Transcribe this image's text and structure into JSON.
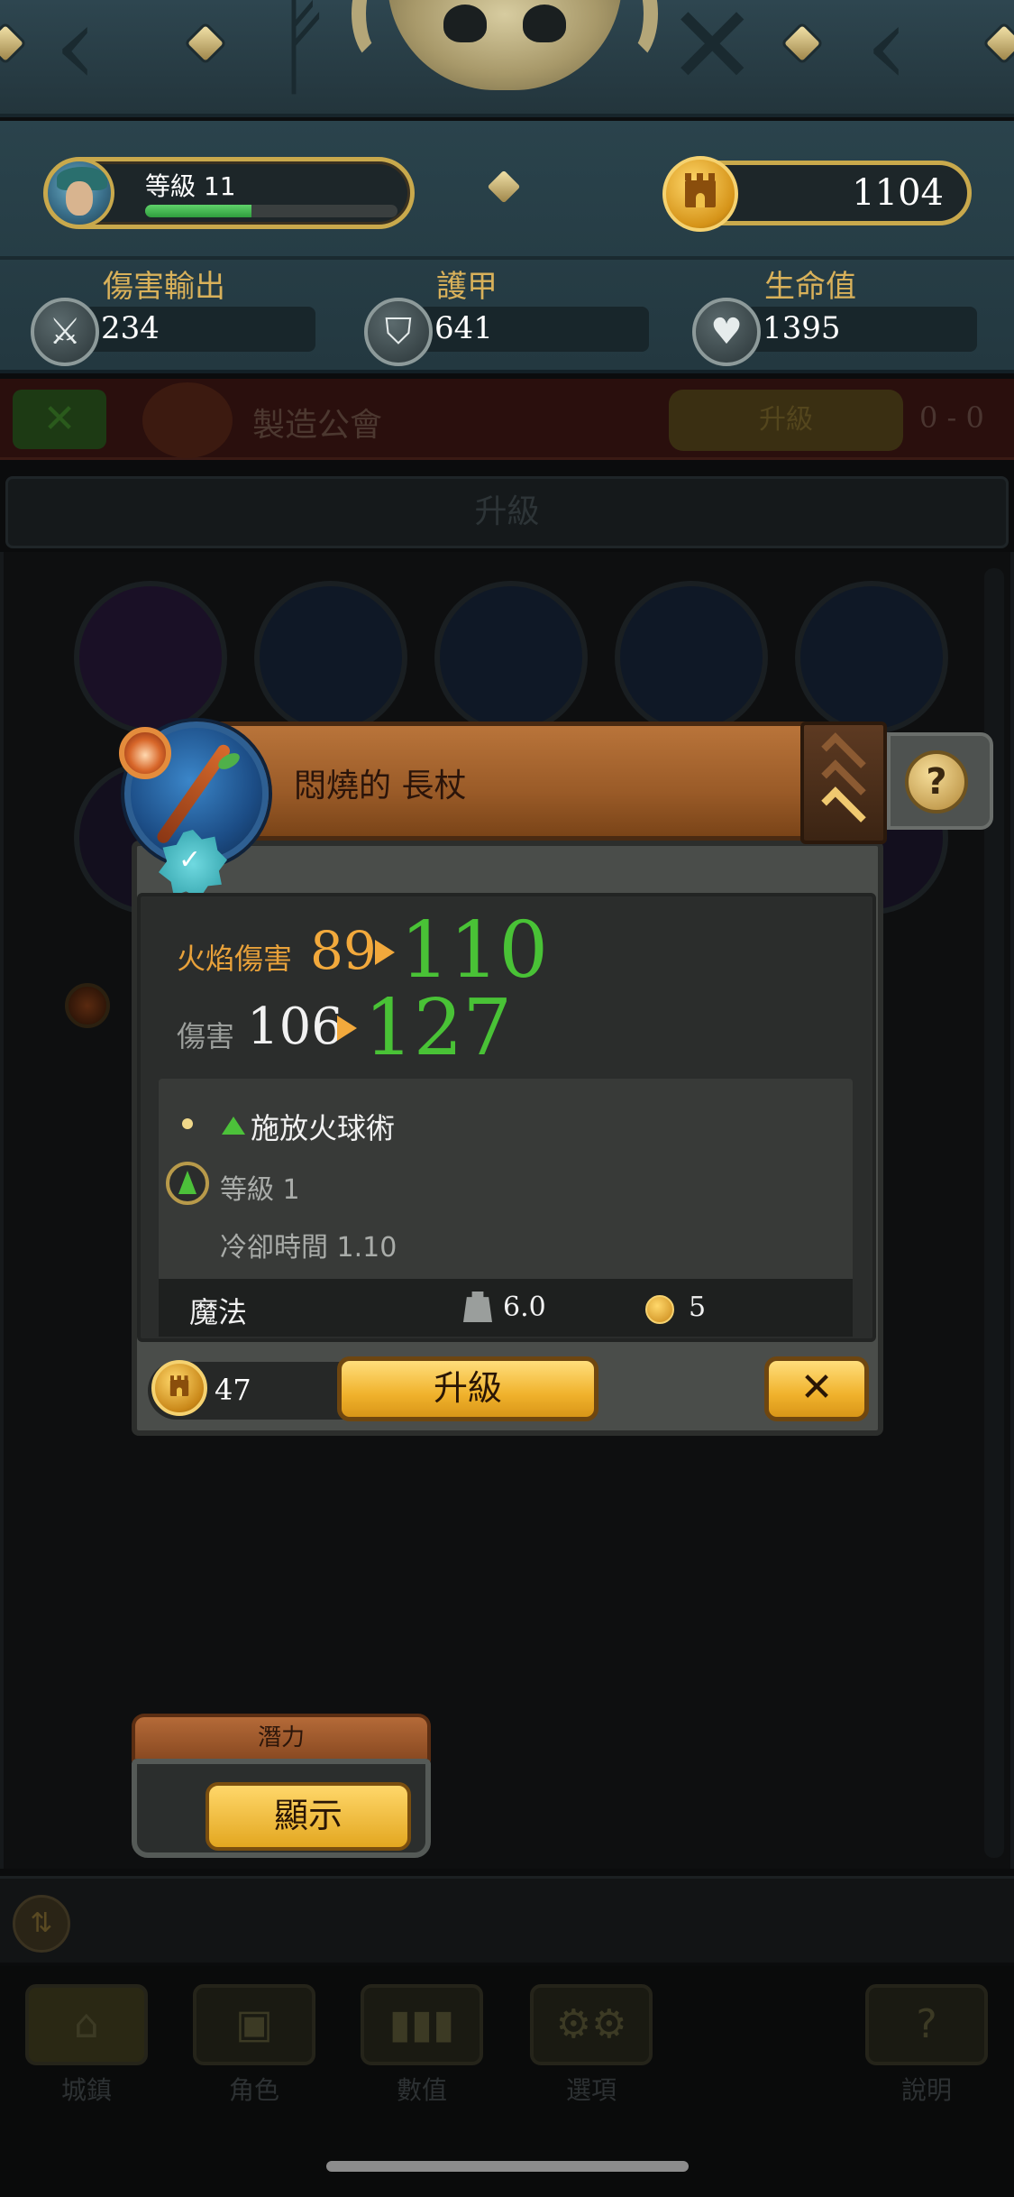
{
  "header": {
    "level_label": "等級 11",
    "xp_fraction": 0.42,
    "gold": "1104"
  },
  "stats": [
    {
      "label": "傷害輸出",
      "value": "234",
      "icon": "sword-icon"
    },
    {
      "label": "護甲",
      "value": "641",
      "icon": "shield-icon"
    },
    {
      "label": "生命值",
      "value": "1395",
      "icon": "heart-icon"
    }
  ],
  "background": {
    "guild_title": "製造公會",
    "guild_upgrade_label": "升級",
    "guild_count": "0 - 0",
    "upgrade_tab_label": "升級",
    "potential_label": "潛力",
    "show_button_label": "顯示"
  },
  "modal": {
    "item_name": "悶燒的 長杖",
    "help_label": "?",
    "stat1": {
      "label": "火焰傷害",
      "old": "89",
      "new": "110"
    },
    "stat2": {
      "label": "傷害",
      "old": "106",
      "new": "127"
    },
    "spell": {
      "name": "施放火球術",
      "level": "等級 1",
      "cooldown": "冷卻時間 1.10"
    },
    "footer": {
      "type": "魔法",
      "weight": "6.0",
      "price": "5"
    },
    "cost": "47",
    "upgrade_label": "升級",
    "close_label": "✕"
  },
  "nav": [
    {
      "label": "城鎮",
      "icon": "town-icon",
      "glyph": "⌂"
    },
    {
      "label": "角色",
      "icon": "character-icon",
      "glyph": "▣"
    },
    {
      "label": "數值",
      "icon": "stats-icon",
      "glyph": "▮▮▮"
    },
    {
      "label": "選項",
      "icon": "gear-icon",
      "glyph": "⚙⚙"
    },
    {
      "label": "說明",
      "icon": "help-icon",
      "glyph": "?"
    }
  ],
  "colors": {
    "accent_gold": "#c9a94c",
    "gain_green": "#49c236",
    "fire_orange": "#e8a13a"
  }
}
